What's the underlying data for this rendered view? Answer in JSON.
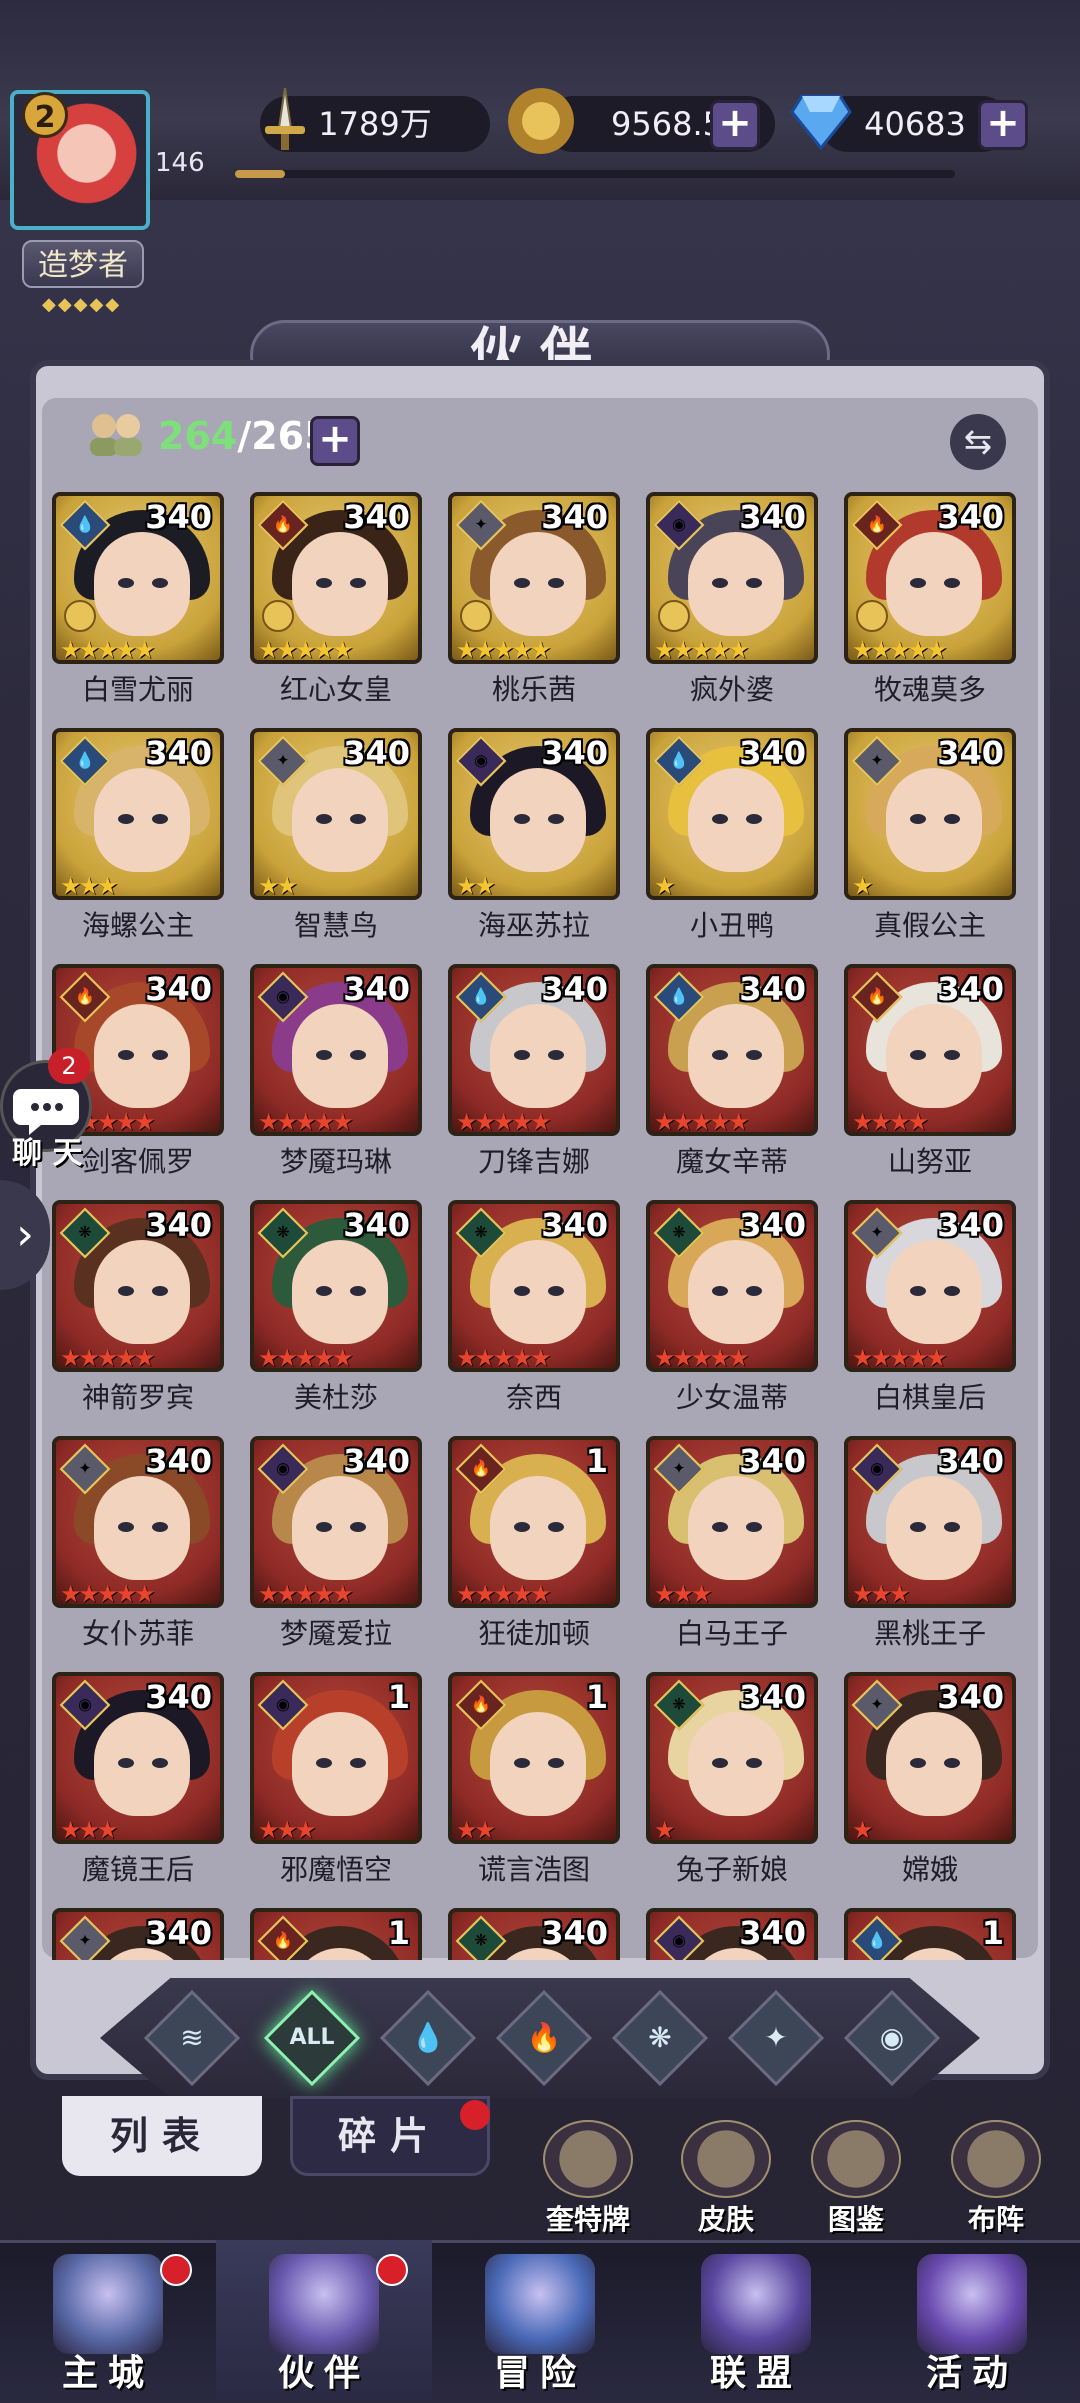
{
  "player": {
    "level": "2",
    "id_number": "146",
    "title": "造梦者",
    "title_stars": "◆◆◆◆◆",
    "exp_progress": 0.07
  },
  "resources": {
    "power": "1789万",
    "gold": "9568.5万",
    "gems": "40683"
  },
  "page": {
    "title": "伙伴"
  },
  "roster": {
    "current": "264",
    "separator": "/",
    "max": "265"
  },
  "element_icons": {
    "water": "💧",
    "fire": "🔥",
    "wind": "❋",
    "light": "✦",
    "dark": "◉"
  },
  "heroes": [
    {
      "name": "白雪尤丽",
      "level": "340",
      "stars": "★★★★★",
      "element": "water",
      "frame": "gold",
      "crown": true,
      "hair": "#1c1c24"
    },
    {
      "name": "红心女皇",
      "level": "340",
      "stars": "★★★★★",
      "element": "fire",
      "frame": "gold",
      "crown": true,
      "hair": "#3a2418"
    },
    {
      "name": "桃乐茜",
      "level": "340",
      "stars": "★★★★★",
      "element": "light",
      "frame": "gold",
      "crown": true,
      "hair": "#8a5a2c"
    },
    {
      "name": "疯外婆",
      "level": "340",
      "stars": "★★★★★",
      "element": "dark",
      "frame": "gold",
      "crown": true,
      "hair": "#4a4458"
    },
    {
      "name": "牧魂莫多",
      "level": "340",
      "stars": "★★★★★",
      "element": "fire",
      "frame": "gold",
      "crown": true,
      "hair": "#b23a2c"
    },
    {
      "name": "海螺公主",
      "level": "340",
      "stars": "★★★",
      "element": "water",
      "frame": "gold",
      "crown": false,
      "hair": "#d8b46a"
    },
    {
      "name": "智慧鸟",
      "level": "340",
      "stars": "★★",
      "element": "light",
      "frame": "gold",
      "crown": false,
      "hair": "#e0c47a"
    },
    {
      "name": "海巫苏拉",
      "level": "340",
      "stars": "★★",
      "element": "dark",
      "frame": "gold",
      "crown": false,
      "hair": "#1c1826"
    },
    {
      "name": "小丑鸭",
      "level": "340",
      "stars": "★",
      "element": "water",
      "frame": "gold",
      "crown": false,
      "hair": "#e8c040"
    },
    {
      "name": "真假公主",
      "level": "340",
      "stars": "★",
      "element": "light",
      "frame": "gold",
      "crown": false,
      "hair": "#d6aa5a"
    },
    {
      "name": "剑客佩罗",
      "level": "340",
      "stars": "★★★★★",
      "element": "fire",
      "frame": "red",
      "crown": false,
      "hair": "#a8482a"
    },
    {
      "name": "梦魇玛琳",
      "level": "340",
      "stars": "★★★★★",
      "element": "dark",
      "frame": "red",
      "crown": false,
      "hair": "#8a3c8a"
    },
    {
      "name": "刀锋吉娜",
      "level": "340",
      "stars": "★★★★★",
      "element": "water",
      "frame": "red",
      "crown": false,
      "hair": "#c8c8cc"
    },
    {
      "name": "魔女辛蒂",
      "level": "340",
      "stars": "★★★★★",
      "element": "water",
      "frame": "red",
      "crown": false,
      "hair": "#c8a050"
    },
    {
      "name": "山努亚",
      "level": "340",
      "stars": "★★★★",
      "element": "fire",
      "frame": "red",
      "crown": false,
      "hair": "#e8e4dc"
    },
    {
      "name": "神箭罗宾",
      "level": "340",
      "stars": "★★★★★",
      "element": "wind",
      "frame": "red",
      "crown": false,
      "hair": "#5a3020"
    },
    {
      "name": "美杜莎",
      "level": "340",
      "stars": "★★★★★",
      "element": "wind",
      "frame": "red",
      "crown": false,
      "hair": "#2c5a3a"
    },
    {
      "name": "奈西",
      "level": "340",
      "stars": "★★★★★",
      "element": "wind",
      "frame": "red",
      "crown": false,
      "hair": "#d8b050"
    },
    {
      "name": "少女温蒂",
      "level": "340",
      "stars": "★★★★★",
      "element": "wind",
      "frame": "red",
      "crown": false,
      "hair": "#d8a858"
    },
    {
      "name": "白棋皇后",
      "level": "340",
      "stars": "★★★★★",
      "element": "light",
      "frame": "red",
      "crown": false,
      "hair": "#d8d8dc"
    },
    {
      "name": "女仆苏菲",
      "level": "340",
      "stars": "★★★★★",
      "element": "light",
      "frame": "red",
      "crown": false,
      "hair": "#8a4a28"
    },
    {
      "name": "梦魇爱拉",
      "level": "340",
      "stars": "★★★★★",
      "element": "dark",
      "frame": "red",
      "crown": false,
      "hair": "#b8884a"
    },
    {
      "name": "狂徒加顿",
      "level": "1",
      "stars": "★★★★★",
      "element": "fire",
      "frame": "red",
      "crown": false,
      "hair": "#d8b050"
    },
    {
      "name": "白马王子",
      "level": "340",
      "stars": "★★★",
      "element": "light",
      "frame": "red",
      "crown": false,
      "hair": "#d8c070"
    },
    {
      "name": "黑桃王子",
      "level": "340",
      "stars": "★★★",
      "element": "dark",
      "frame": "red",
      "crown": false,
      "hair": "#c8c8cc"
    },
    {
      "name": "魔镜王后",
      "level": "340",
      "stars": "★★★",
      "element": "dark",
      "frame": "red",
      "crown": false,
      "hair": "#1c1826"
    },
    {
      "name": "邪魔悟空",
      "level": "1",
      "stars": "★★★",
      "element": "dark",
      "frame": "red",
      "crown": false,
      "hair": "#b8402a"
    },
    {
      "name": "谎言浩图",
      "level": "1",
      "stars": "★★",
      "element": "fire",
      "frame": "red",
      "crown": false,
      "hair": "#c89a40"
    },
    {
      "name": "兔子新娘",
      "level": "340",
      "stars": "★",
      "element": "wind",
      "frame": "red",
      "crown": false,
      "hair": "#e8d4a0"
    },
    {
      "name": "嫦娥",
      "level": "340",
      "stars": "★",
      "element": "light",
      "frame": "red",
      "crown": false,
      "hair": "#3a2820"
    },
    {
      "name": "",
      "level": "340",
      "stars": "",
      "element": "light",
      "frame": "red",
      "crown": false,
      "hair": "#3a2820"
    },
    {
      "name": "",
      "level": "1",
      "stars": "",
      "element": "fire",
      "frame": "red",
      "crown": false,
      "hair": "#3a2820"
    },
    {
      "name": "",
      "level": "340",
      "stars": "",
      "element": "wind",
      "frame": "red",
      "crown": false,
      "hair": "#3a2820"
    },
    {
      "name": "",
      "level": "340",
      "stars": "",
      "element": "dark",
      "frame": "red",
      "crown": false,
      "hair": "#3a2820"
    },
    {
      "name": "",
      "level": "1",
      "stars": "",
      "element": "water",
      "frame": "red",
      "crown": false,
      "hair": "#3a2820"
    }
  ],
  "chat": {
    "label": "聊 天",
    "badge": "2"
  },
  "filters": [
    {
      "id": "wind-a",
      "glyph": "≋"
    },
    {
      "id": "all",
      "glyph": "ALL"
    },
    {
      "id": "water",
      "glyph": "💧"
    },
    {
      "id": "fire",
      "glyph": "🔥"
    },
    {
      "id": "wind",
      "glyph": "❋"
    },
    {
      "id": "light",
      "glyph": "✦"
    },
    {
      "id": "dark",
      "glyph": "◉"
    }
  ],
  "tabs": {
    "list": "列表",
    "shards": "碎片"
  },
  "sub_buttons": [
    {
      "id": "tarot",
      "label": "奎特牌"
    },
    {
      "id": "skin",
      "label": "皮肤"
    },
    {
      "id": "codex",
      "label": "图鉴"
    },
    {
      "id": "formation",
      "label": "布阵"
    }
  ],
  "nav": [
    {
      "id": "city",
      "label": "主城",
      "dot": true,
      "color": "#5a6aa8"
    },
    {
      "id": "partner",
      "label": "伙伴",
      "dot": true,
      "color": "#6a5ab0"
    },
    {
      "id": "adventure",
      "label": "冒险",
      "dot": false,
      "color": "#4a6ab8"
    },
    {
      "id": "alliance",
      "label": "联盟",
      "dot": false,
      "color": "#5a48a0"
    },
    {
      "id": "events",
      "label": "活动",
      "dot": false,
      "color": "#6a4ab0"
    }
  ],
  "colors": {
    "gold_frame": "#c9a23a",
    "red_frame": "#8e2a26",
    "star_gold": "#f5c431",
    "star_red": "#e8452c",
    "accent_green": "#7ee07a"
  }
}
